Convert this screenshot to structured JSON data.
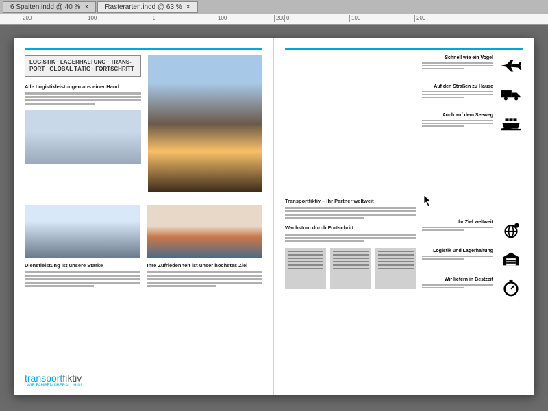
{
  "tabs": [
    {
      "label": "6 Spalten.indd @ 40 %",
      "active": false
    },
    {
      "label": "Rasterarten.indd @ 63 %",
      "active": true
    }
  ],
  "ruler_marks": [
    "200",
    "100",
    "0",
    "100",
    "200",
    "0",
    "100",
    "200"
  ],
  "left_page": {
    "tagline": "LOGISTIK · LAGERHALTUNG · TRANS-\nPORT · GLOBAL TÄTIG · FORTSCHRITT",
    "heading1": "Alle Logistikleistungen aus einer Hand",
    "heading2": "Dienstleistung ist unsere Stärke",
    "heading3": "Ihre Zufriedenheit ist unser höchstes Ziel",
    "logo_a": "transport",
    "logo_b": "fiktiv",
    "logo_sub": "WIR FAHREN ÜBERALL HIN!"
  },
  "right_page": {
    "features_top": [
      {
        "title": "Schnell wie ein Vogel",
        "icon": "airplane-icon"
      },
      {
        "title": "Auf den Straßen zu Hause",
        "icon": "truck-icon"
      },
      {
        "title": "Auch auf dem Seeweg",
        "icon": "ship-icon"
      }
    ],
    "section1": "Transportfiktiv – Ihr Partner weltweit",
    "section2": "Wachstum durch Fortschritt",
    "features_side": [
      {
        "title": "Ihr Ziel weltweit",
        "icon": "globe-icon"
      },
      {
        "title": "Logistik und Lagerhaltung",
        "icon": "warehouse-icon"
      },
      {
        "title": "Wir liefern in Bestzeit",
        "icon": "stopwatch-icon"
      }
    ]
  }
}
